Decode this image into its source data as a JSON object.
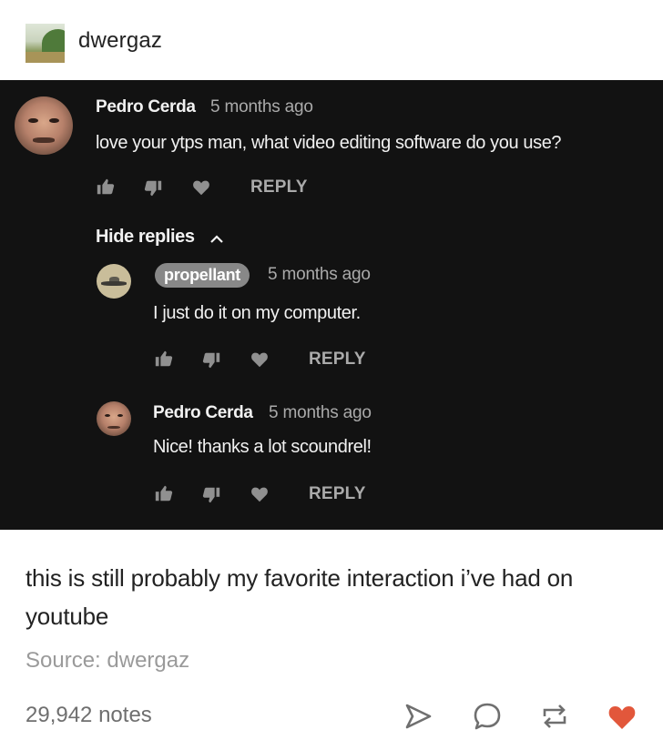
{
  "post": {
    "blog_name": "dwergaz",
    "caption": "this is still probably my favorite interaction i’ve had on youtube",
    "source_label": "Source:",
    "source_name": "dwergaz",
    "notes": "29,942 notes"
  },
  "screenshot": {
    "comment": {
      "author": "Pedro Cerda",
      "time": "5 months ago",
      "text": "love your ytps man, what video editing software do you use?",
      "reply_label": "REPLY"
    },
    "hide_replies_label": "Hide replies",
    "replies": [
      {
        "author": "propellant",
        "time": "5 months ago",
        "text": "I just do it on my computer.",
        "reply_label": "REPLY"
      },
      {
        "author": "Pedro Cerda",
        "time": "5 months ago",
        "text": "Nice! thanks a lot scoundrel!",
        "reply_label": "REPLY"
      }
    ]
  },
  "icons": {
    "like": "thumbs-up-icon",
    "dislike": "thumbs-down-icon",
    "heart": "heart-icon",
    "share": "share-icon",
    "reply": "chat-bubble-icon",
    "reblog": "reblog-icon",
    "like_post": "heart-filled-icon"
  },
  "colors": {
    "dark_bg": "#121212",
    "heart_accent": "#e2573b",
    "badge_bg": "#888888"
  }
}
